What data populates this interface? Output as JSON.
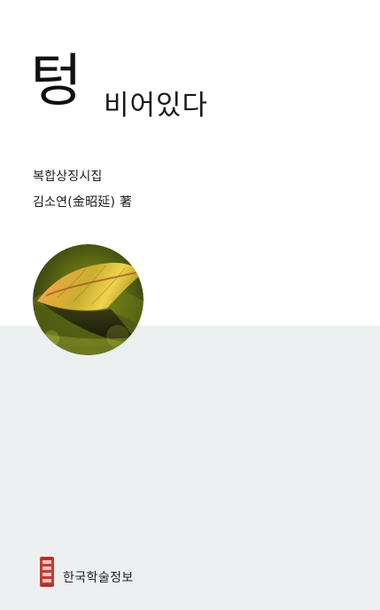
{
  "cover": {
    "title_main": "텅",
    "title_sub": "비어있다",
    "genre": "복합상징시집",
    "author": "김소연(金昭延) 著",
    "publisher": "한국학술정보",
    "colors": {
      "background": "#ffffff",
      "lower_panel": "#eceff0",
      "text": "#151515",
      "seal": "#c33a35"
    },
    "image": {
      "name": "autumn-leaf-photo",
      "description_role": "circular cover photograph"
    },
    "seal_icon": "publisher-seal-icon"
  }
}
